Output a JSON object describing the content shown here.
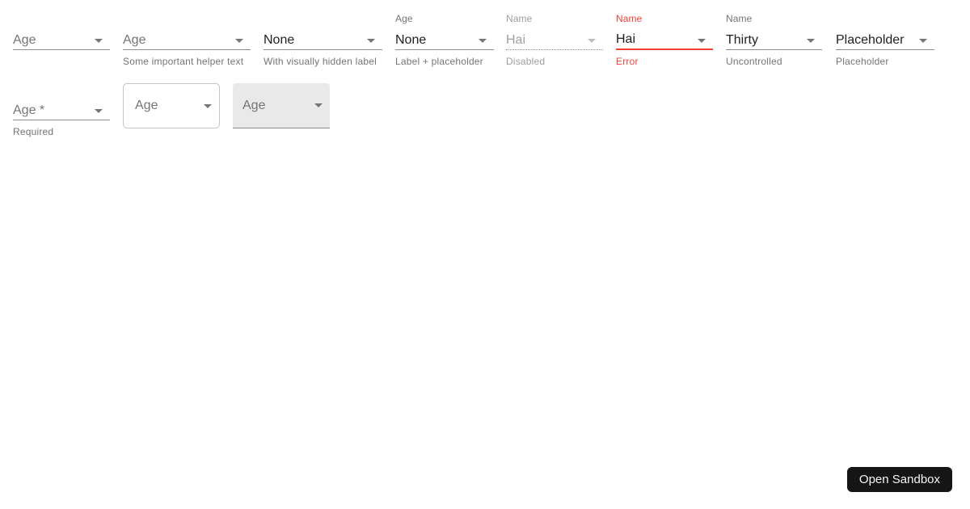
{
  "colors": {
    "background": "#ffffff",
    "text_primary": "#212121",
    "text_secondary": "#757575",
    "text_disabled": "#9e9e9e",
    "error": "#f44336",
    "underline": "#8f8f8f",
    "outlined_border": "#c4c4c4",
    "filled_background": "#e9e9e9",
    "button_background": "#151515",
    "button_text": "#f5f5f5"
  },
  "selects": [
    {
      "label": "",
      "value": "Age",
      "helper": ""
    },
    {
      "label": "",
      "value": "Age",
      "helper": "Some important helper text"
    },
    {
      "label": "",
      "value": "None",
      "helper": "With visually hidden label"
    },
    {
      "label": "Age",
      "value": "None",
      "helper": "Label + placeholder"
    },
    {
      "label": "Name",
      "value": "Hai",
      "helper": "Disabled"
    },
    {
      "label": "Name",
      "value": "Hai",
      "helper": "Error"
    },
    {
      "label": "Name",
      "value": "Thirty",
      "helper": "Uncontrolled"
    },
    {
      "label": "",
      "value": "Placeholder",
      "helper": "Placeholder"
    },
    {
      "label": "",
      "value": "Age *",
      "helper": "Required"
    },
    {
      "label": "",
      "value": "Age",
      "helper": ""
    },
    {
      "label": "",
      "value": "Age",
      "helper": ""
    }
  ],
  "sandbox_button": {
    "label": "Open Sandbox"
  }
}
